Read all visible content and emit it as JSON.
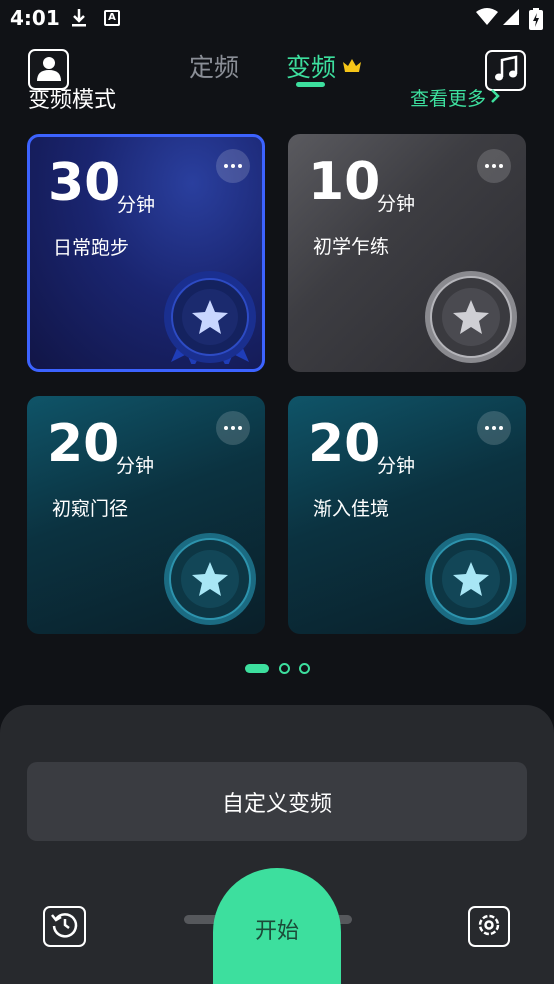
{
  "status_bar": {
    "time": "4:01",
    "a_icon_text": "A"
  },
  "header": {
    "tabs": [
      {
        "label": "定频",
        "active": false
      },
      {
        "label": "变频",
        "active": true
      }
    ],
    "section_title": "变频模式",
    "more_label": "查看更多"
  },
  "cards": [
    {
      "minutes": "30",
      "unit": "分钟",
      "name": "日常跑步",
      "badge": "blue-medal",
      "selected": true
    },
    {
      "minutes": "10",
      "unit": "分钟",
      "name": "初学乍练",
      "badge": "silver-star",
      "selected": false
    },
    {
      "minutes": "20",
      "unit": "分钟",
      "name": "初窥门径",
      "badge": "teal-star",
      "selected": false
    },
    {
      "minutes": "20",
      "unit": "分钟",
      "name": "渐入佳境",
      "badge": "teal-star",
      "selected": false
    }
  ],
  "pager": {
    "total": 3,
    "current": 1
  },
  "bottom": {
    "custom_label": "自定义变频",
    "start_label": "开始"
  },
  "colors": {
    "accent": "#3ddf9e",
    "background": "#101216",
    "selected_border": "#3c63ff",
    "sheet": "#27292d"
  },
  "icons": [
    "download-icon",
    "a-icon",
    "wifi-icon",
    "signal-icon",
    "battery-icon",
    "avatar-icon",
    "music-icon",
    "crown-icon",
    "chevron-right-icon",
    "more-dots-icon",
    "star-badge-icon",
    "history-icon",
    "settings-icon"
  ]
}
